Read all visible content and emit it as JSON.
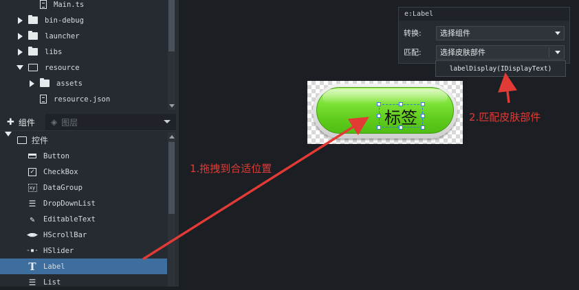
{
  "file_tree": [
    {
      "label": "Main.ts",
      "type": "file",
      "depth": 2
    },
    {
      "label": "bin-debug",
      "type": "folder",
      "expanded": false,
      "depth": 1
    },
    {
      "label": "launcher",
      "type": "folder",
      "expanded": false,
      "depth": 1
    },
    {
      "label": "libs",
      "type": "folder",
      "expanded": false,
      "depth": 1
    },
    {
      "label": "resource",
      "type": "folder",
      "expanded": true,
      "depth": 1
    },
    {
      "label": "assets",
      "type": "folder",
      "expanded": false,
      "depth": 2
    },
    {
      "label": "resource.json",
      "type": "file",
      "depth": 2
    }
  ],
  "tabs": {
    "components": "组件",
    "layers": "图层"
  },
  "component_tree": {
    "group_label": "控件",
    "items": [
      {
        "label": "Button",
        "icon": "button-icon"
      },
      {
        "label": "CheckBox",
        "icon": "checkbox-icon"
      },
      {
        "label": "DataGroup",
        "icon": "datagroup-icon"
      },
      {
        "label": "DropDownList",
        "icon": "dropdownlist-icon"
      },
      {
        "label": "EditableText",
        "icon": "editabletext-icon"
      },
      {
        "label": "HScrollBar",
        "icon": "hscrollbar-icon"
      },
      {
        "label": "HSlider",
        "icon": "hslider-icon"
      },
      {
        "label": "Label",
        "icon": "label-icon",
        "selected": true
      },
      {
        "label": "List",
        "icon": "list-icon"
      }
    ]
  },
  "canvas": {
    "label_text": "标签"
  },
  "properties_panel": {
    "title": "e:Label",
    "convert_label": "转换:",
    "convert_value": "选择组件",
    "match_label": "匹配:",
    "match_value": "选择皮肤部件",
    "popup_option": "labelDisplay(IDisplayText)"
  },
  "annotations": {
    "step1": "1.拖拽到合适位置",
    "step2": "2.匹配皮肤部件",
    "color": "#e23b36"
  }
}
